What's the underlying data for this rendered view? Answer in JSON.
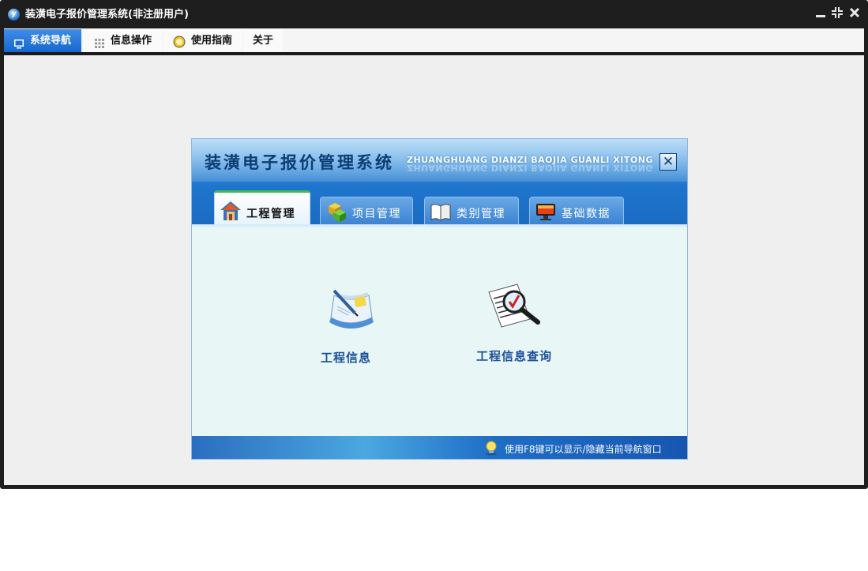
{
  "window": {
    "title": "装潢电子报价管理系统(非注册用户)",
    "controls": {
      "minimize": "minimize-icon",
      "restore": "restore-icon",
      "close": "close-icon"
    }
  },
  "menu": {
    "tabs": [
      {
        "label": "系统导航",
        "icon": "monitor-icon",
        "active": true
      },
      {
        "label": "信息操作",
        "icon": "grid-icon",
        "active": false
      },
      {
        "label": "使用指南",
        "icon": "guide-icon",
        "active": false
      },
      {
        "label": "关于",
        "icon": "",
        "active": false
      }
    ]
  },
  "nav": {
    "title": "装潢电子报价管理系统",
    "subtitle": "ZHUANGHUANG DIANZI BAOJIA GUANLI XITONG",
    "close_symbol": "✕",
    "tabs": [
      {
        "label": "工程管理",
        "icon": "house-icon",
        "active": true
      },
      {
        "label": "项目管理",
        "icon": "cubes-icon",
        "active": false
      },
      {
        "label": "类别管理",
        "icon": "book-icon",
        "active": false
      },
      {
        "label": "基础数据",
        "icon": "monitor-icon",
        "active": false
      }
    ],
    "items": [
      {
        "label": "工程信息",
        "icon": "document-pen-icon"
      },
      {
        "label": "工程信息查询",
        "icon": "magnifier-document-icon"
      }
    ],
    "footer_tip": "使用F8键可以显示/隐藏当前导航窗口"
  },
  "colors": {
    "accent": "#1767cf",
    "title_bar": "#1e1e1e",
    "nav_label": "#1d4f9a",
    "active_tab_border": "#38c04a"
  }
}
